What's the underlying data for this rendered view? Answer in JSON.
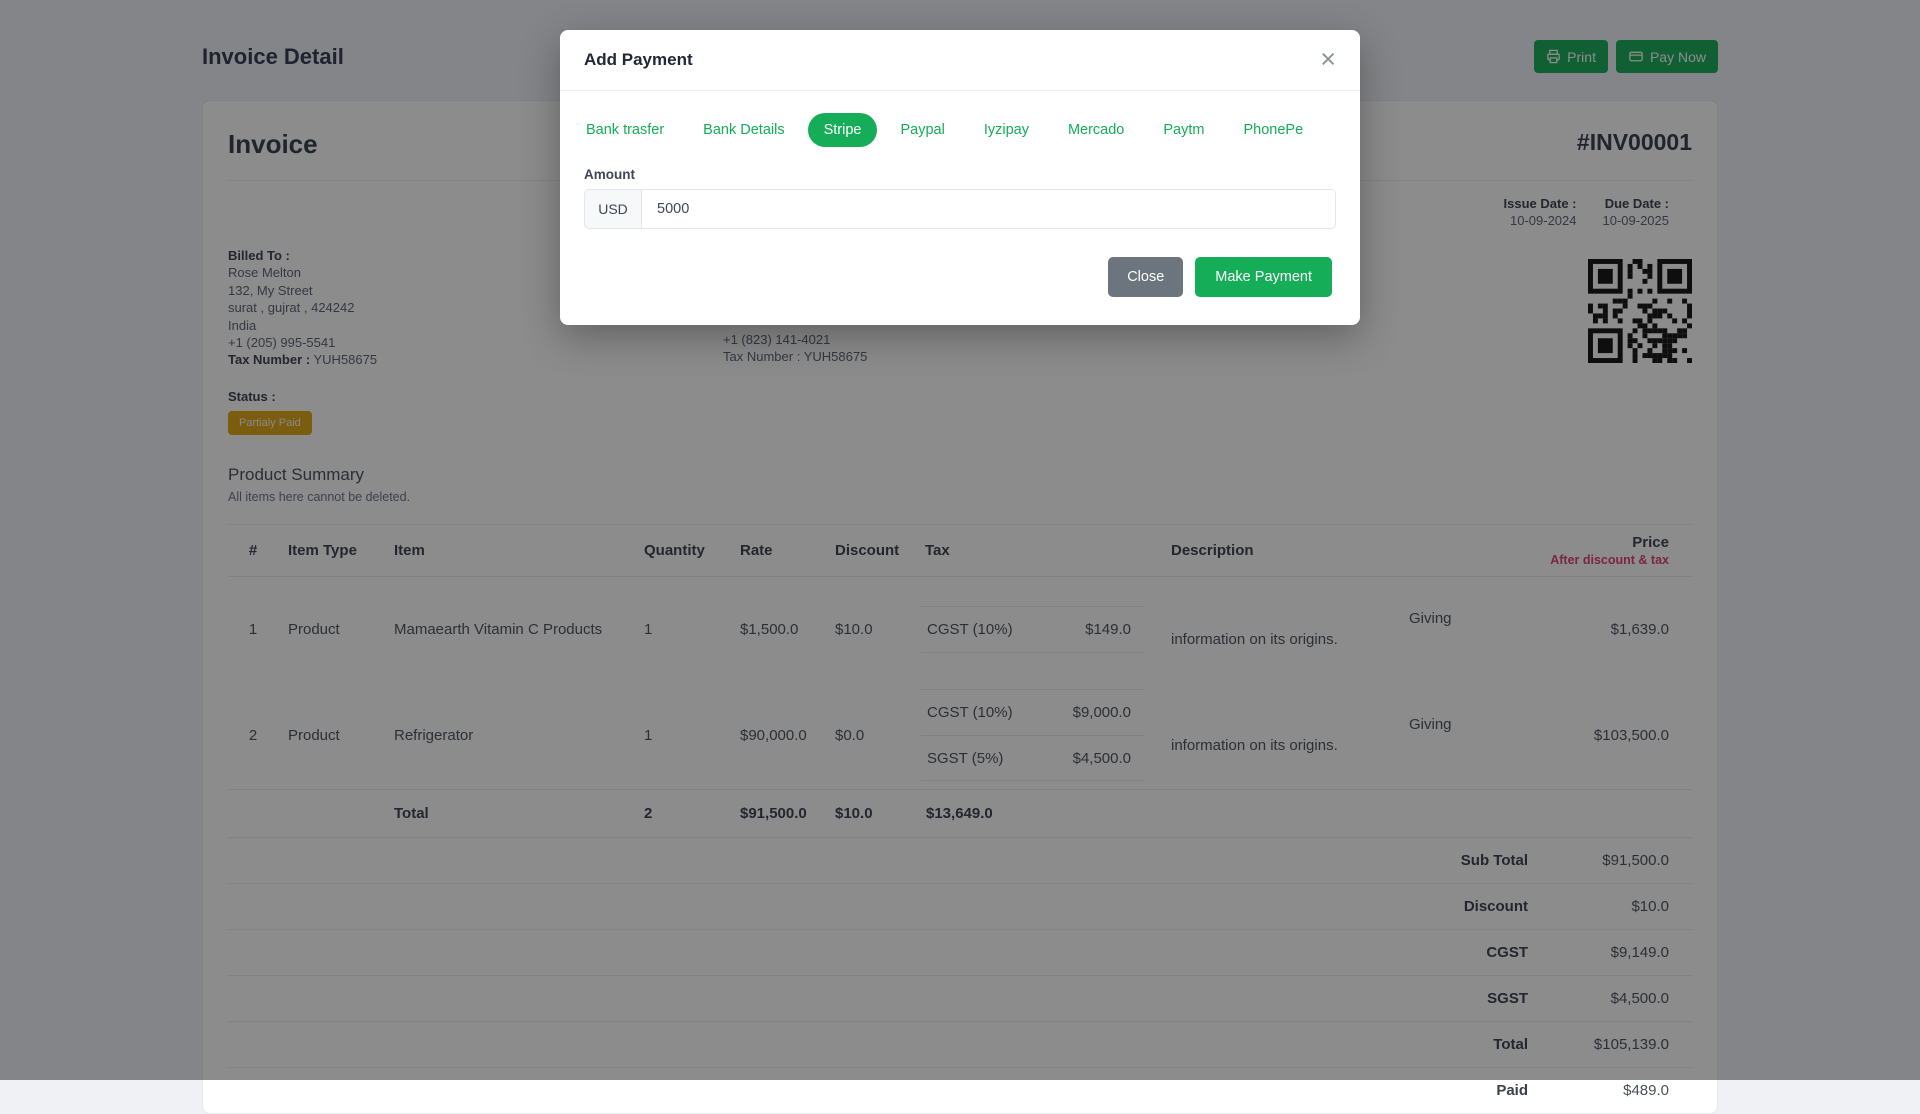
{
  "colors": {
    "accent_green": "#15ad58",
    "badge_amber": "#dfa712",
    "price_note_red": "#dd3f6e"
  },
  "page": {
    "title": "Invoice Detail",
    "print_label": "Print",
    "pay_now_label": "Pay Now"
  },
  "invoice": {
    "heading": "Invoice",
    "number": "#INV00001",
    "issue_date_label": "Issue Date :",
    "issue_date": "10-09-2024",
    "due_date_label": "Due Date :",
    "due_date": "10-09-2025",
    "billed_to": {
      "label": "Billed To :",
      "name": "Rose Melton",
      "address1": "132, My Street",
      "address2": "surat , gujrat , 424242",
      "country": "India",
      "phone": "+1 (205) 995-5541",
      "tax_label": "Tax Number :",
      "tax_number": "YUH58675"
    },
    "shipped_to_visible": {
      "phone": "+1 (823) 141-4021",
      "tax_label": "Tax Number :",
      "tax_number": "YUH58675"
    },
    "status_label": "Status :",
    "status_badge": "Partialy Paid"
  },
  "product_summary": {
    "heading": "Product Summary",
    "note": "All items here cannot be deleted.",
    "columns": {
      "num": "#",
      "item_type": "Item Type",
      "item": "Item",
      "quantity": "Quantity",
      "rate": "Rate",
      "discount": "Discount",
      "tax": "Tax",
      "description": "Description",
      "price": "Price",
      "price_note": "After discount & tax"
    },
    "rows": [
      {
        "num": "1",
        "type": "Product",
        "item": "Mamaearth Vitamin C Products",
        "qty": "1",
        "rate": "$1,500.0",
        "discount": "$10.0",
        "taxes": [
          {
            "label": "CGST (10%)",
            "value": "$149.0"
          }
        ],
        "description": "Giving information on its origins.",
        "price": "$1,639.0"
      },
      {
        "num": "2",
        "type": "Product",
        "item": "Refrigerator",
        "qty": "1",
        "rate": "$90,000.0",
        "discount": "$0.0",
        "taxes": [
          {
            "label": "CGST (10%)",
            "value": "$9,000.0"
          },
          {
            "label": "SGST (5%)",
            "value": "$4,500.0"
          }
        ],
        "description": "Giving information on its origins.",
        "price": "$103,500.0"
      }
    ],
    "total_row": {
      "label": "Total",
      "qty": "2",
      "rate": "$91,500.0",
      "discount": "$10.0",
      "tax": "$13,649.0"
    },
    "totals": [
      {
        "label": "Sub Total",
        "value": "$91,500.0"
      },
      {
        "label": "Discount",
        "value": "$10.0"
      },
      {
        "label": "CGST",
        "value": "$9,149.0"
      },
      {
        "label": "SGST",
        "value": "$4,500.0"
      },
      {
        "label": "Total",
        "value": "$105,139.0"
      },
      {
        "label": "Paid",
        "value": "$489.0"
      }
    ]
  },
  "modal": {
    "title": "Add Payment",
    "close_icon": "×",
    "tabs": [
      {
        "label": "Bank trasfer"
      },
      {
        "label": "Bank Details"
      },
      {
        "label": "Stripe"
      },
      {
        "label": "Paypal"
      },
      {
        "label": "Iyzipay"
      },
      {
        "label": "Mercado"
      },
      {
        "label": "Paytm"
      },
      {
        "label": "PhonePe"
      }
    ],
    "amount_label": "Amount",
    "currency": "USD",
    "amount_value": "5000",
    "close_label": "Close",
    "submit_label": "Make Payment"
  }
}
